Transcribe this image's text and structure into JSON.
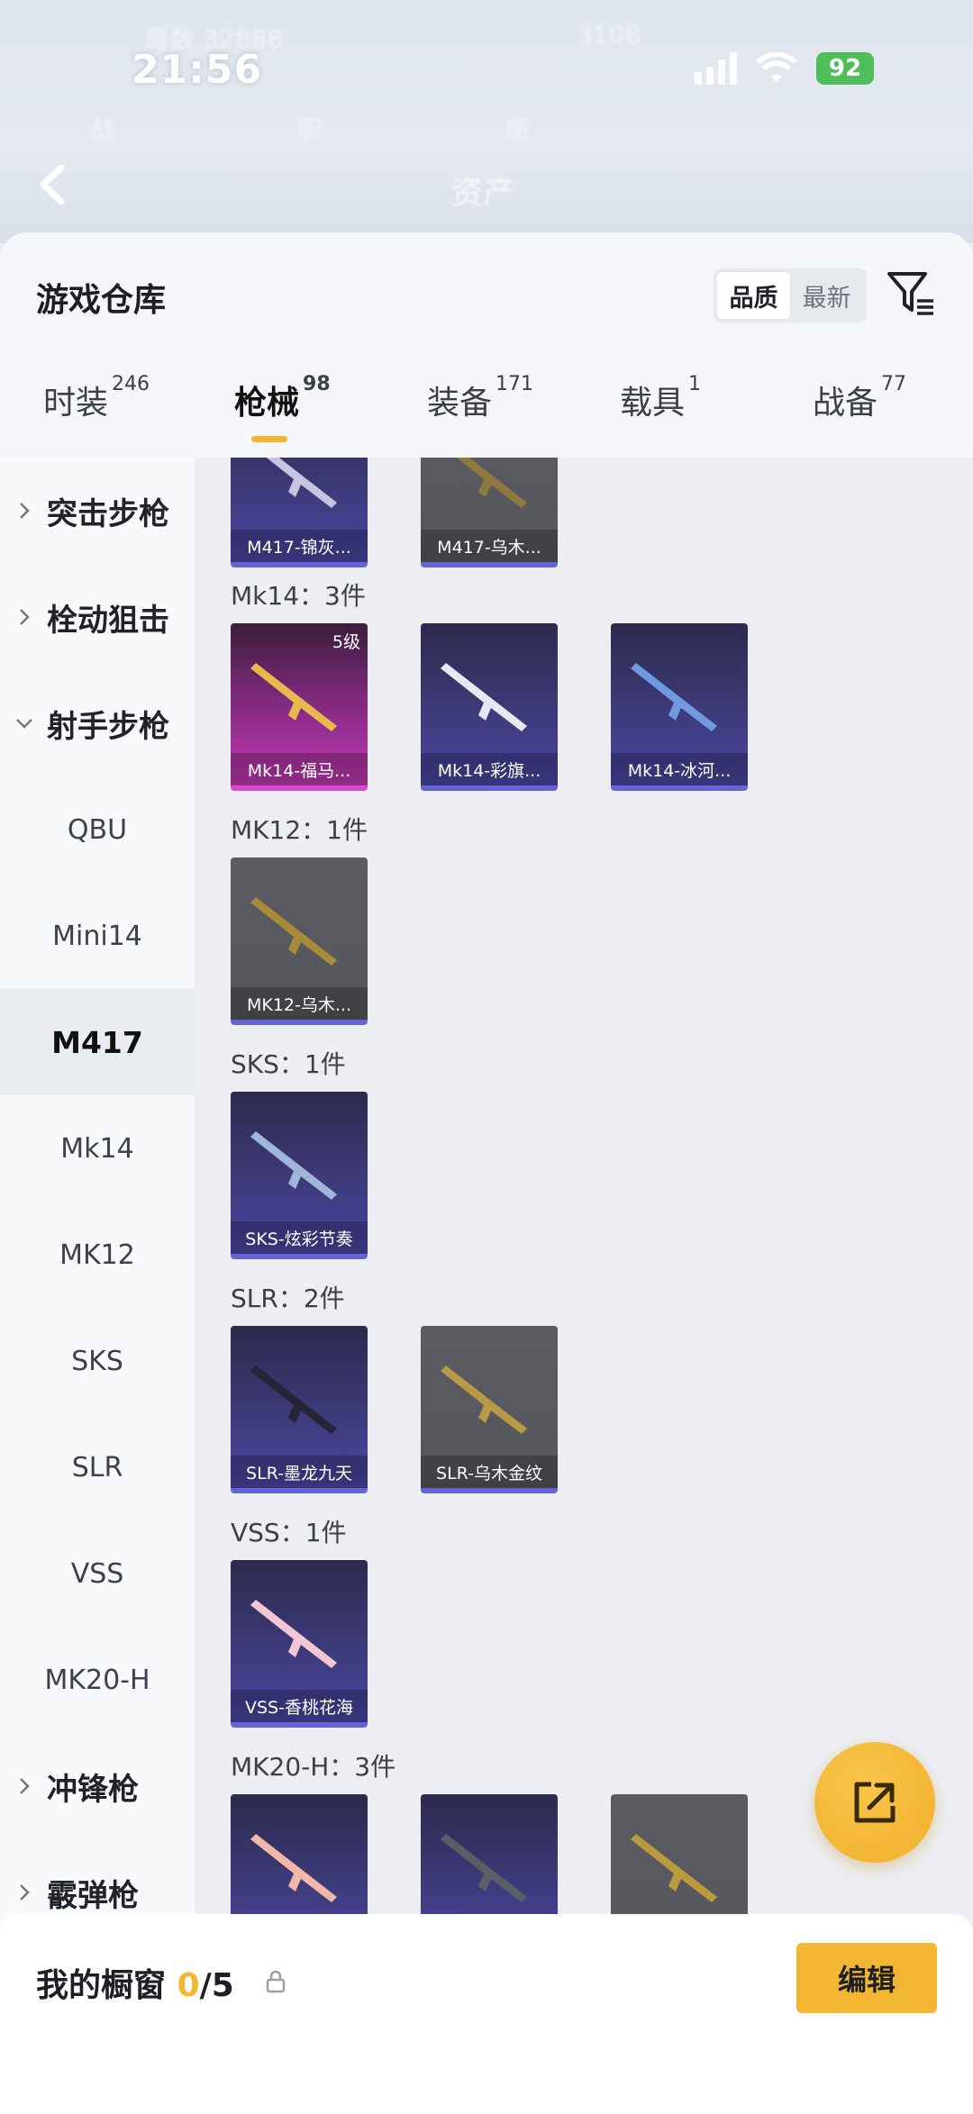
{
  "status_bar": {
    "time": "21:56",
    "battery": "92"
  },
  "header": {
    "blurred_title": "资产"
  },
  "sheet": {
    "title": "游戏仓库",
    "sort": {
      "options": [
        "品质",
        "最新"
      ],
      "active": "品质"
    }
  },
  "tabs": [
    {
      "label": "时装",
      "count": "246"
    },
    {
      "label": "枪械",
      "count": "98"
    },
    {
      "label": "装备",
      "count": "171"
    },
    {
      "label": "载具",
      "count": "1"
    },
    {
      "label": "战备",
      "count": "77"
    }
  ],
  "categories": [
    {
      "label": "突击步枪",
      "type": "group",
      "expanded": false
    },
    {
      "label": "栓动狙击",
      "type": "group",
      "expanded": false
    },
    {
      "label": "射手步枪",
      "type": "group",
      "expanded": true
    },
    {
      "label": "QBU",
      "type": "sub"
    },
    {
      "label": "Mini14",
      "type": "sub"
    },
    {
      "label": "M417",
      "type": "sub",
      "active": true
    },
    {
      "label": "Mk14",
      "type": "sub"
    },
    {
      "label": "MK12",
      "type": "sub"
    },
    {
      "label": "SKS",
      "type": "sub"
    },
    {
      "label": "SLR",
      "type": "sub"
    },
    {
      "label": "VSS",
      "type": "sub"
    },
    {
      "label": "MK20-H",
      "type": "sub"
    },
    {
      "label": "冲锋枪",
      "type": "group",
      "expanded": false
    },
    {
      "label": "霰弹枪",
      "type": "group",
      "expanded": false
    }
  ],
  "sections": [
    {
      "header": "",
      "items": [
        {
          "name": "M417-锦灰...",
          "style": "purple"
        },
        {
          "name": "M417-乌木...",
          "style": "grey"
        }
      ]
    },
    {
      "header": "Mk14：3件",
      "items": [
        {
          "name": "Mk14-福马...",
          "style": "pink",
          "level": "5级"
        },
        {
          "name": "Mk14-彩旗...",
          "style": "purple"
        },
        {
          "name": "Mk14-冰河...",
          "style": "purple"
        }
      ]
    },
    {
      "header": "MK12：1件",
      "items": [
        {
          "name": "MK12-乌木...",
          "style": "grey"
        }
      ]
    },
    {
      "header": "SKS：1件",
      "items": [
        {
          "name": "SKS-炫彩节奏",
          "style": "purple"
        }
      ]
    },
    {
      "header": "SLR：2件",
      "items": [
        {
          "name": "SLR-墨龙九天",
          "style": "purple"
        },
        {
          "name": "SLR-乌木金纹",
          "style": "grey"
        }
      ]
    },
    {
      "header": "VSS：1件",
      "items": [
        {
          "name": "VSS-香桃花海",
          "style": "purple"
        }
      ]
    },
    {
      "header": "MK20-H：3件",
      "items": [
        {
          "name": "",
          "style": "purple"
        },
        {
          "name": "",
          "style": "purple"
        },
        {
          "name": "",
          "style": "grey"
        }
      ]
    }
  ],
  "showcase": {
    "title": "我的橱窗",
    "used": "0",
    "total": "/5",
    "edit_label": "编辑"
  },
  "colors": {
    "accent": "#f2b632",
    "purple_card": "#3d3a7a",
    "grey_card": "#55575d",
    "pink_card": "#8a2c86"
  },
  "icons": [
    "back-arrow-icon",
    "filter-icon",
    "chevron-right-icon",
    "chevron-down-icon",
    "share-icon",
    "lock-icon",
    "wifi-icon",
    "signal-icon"
  ]
}
